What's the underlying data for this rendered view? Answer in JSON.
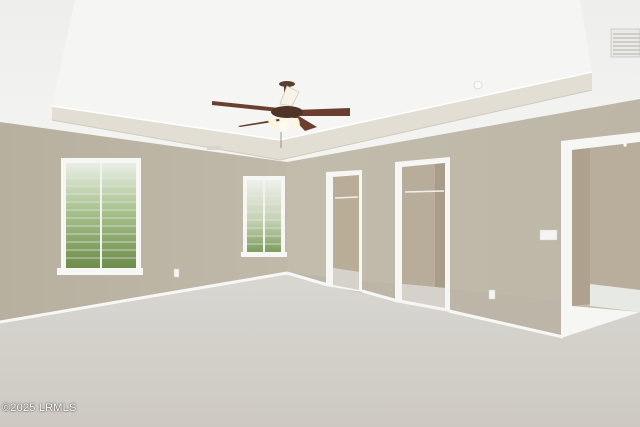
{
  "photo": {
    "watermark": "©2025 LRMLS"
  },
  "colors": {
    "ceiling": "#f1f1ef",
    "tray": "#f6f6f4",
    "wall": "#bcb5a5",
    "wall_right": "#c3bcad",
    "carpet": "#d3d0ca",
    "trim": "#fbfbfa",
    "fan_blade": "#6b3f2f",
    "closet_interior": "#b6ab98"
  }
}
